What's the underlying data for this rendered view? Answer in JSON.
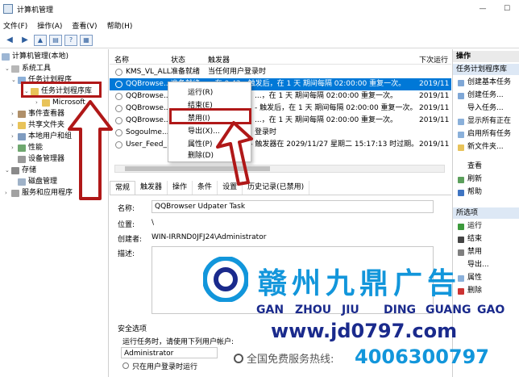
{
  "window": {
    "title": "计算机管理"
  },
  "menu": [
    "文件(F)",
    "操作(A)",
    "查看(V)",
    "帮助(H)"
  ],
  "tree": {
    "root": "计算机管理(本地)",
    "system_tools": "系统工具",
    "task_scheduler": "任务计划程序",
    "task_library": "任务计划程序库",
    "microsoft": "Microsoft",
    "event_viewer": "事件查看器",
    "shared_folders": "共享文件夹",
    "local_users": "本地用户和组",
    "performance": "性能",
    "device_manager": "设备管理器",
    "storage": "存储",
    "disk_management": "磁盘管理",
    "services": "服务和应用程序"
  },
  "grid": {
    "headers": {
      "name": "名称",
      "status": "状态",
      "triggers": "触发器",
      "next_run": "下次运行"
    },
    "rows": [
      {
        "name": "KMS_VL_ALL",
        "status": "准备就绪",
        "trigger": "当任何用户登录时",
        "next": ""
      },
      {
        "name": "QQBrowse...",
        "status": "准备就绪",
        "trigger": "...在 0:42 - 触发后，在 1 天 期间每隔 02:00:00 重复一次。",
        "next": "2019/11"
      },
      {
        "name": "QQBrowse...",
        "status": "",
        "trigger": "...，在 1 天 期间每隔 02:00:00 重复一次。",
        "next": "2019/11"
      },
      {
        "name": "QQBrowse...",
        "status": "",
        "trigger": "- 触发后，在 1 天 期间每隔 02:00:00 重复一次。",
        "next": "2019/11"
      },
      {
        "name": "QQBrowse...",
        "status": "",
        "trigger": "...，在 1 天 期间每隔 02:00:00 重复一次。",
        "next": "2019/11"
      },
      {
        "name": "Sogoulme...",
        "status": "",
        "trigger": "登录时",
        "next": ""
      },
      {
        "name": "User_Feed_...",
        "status": "",
        "trigger": "17 - 触发器在 2029/11/27 星期二 15:17:13 时过期。",
        "next": "2019/11"
      }
    ]
  },
  "context_menu": [
    "运行(R)",
    "结束(E)",
    "禁用(I)",
    "导出(X)...",
    "属性(P)",
    "删除(D)"
  ],
  "tabs": [
    "常规",
    "触发器",
    "操作",
    "条件",
    "设置",
    "历史记录(已禁用)"
  ],
  "detail": {
    "name_label": "名称:",
    "name_value": "QQBrowser Udpater Task",
    "location_label": "位置:",
    "location_value": "\\",
    "author_label": "创建者:",
    "author_value": "WIN-IRRND0JFJ24\\Administrator",
    "desc_label": "描述:",
    "security_label": "安全选项",
    "run_as_text": "运行任务时，请使用下列用户帐户:",
    "account_value": "Administrator",
    "radio_text": "只在用户登录时运行"
  },
  "actions": {
    "header": "操作",
    "section1": "任务计划程序库",
    "items1": [
      "创建基本任务",
      "创建任务...",
      "导入任务...",
      "显示所有正在",
      "启用所有任务",
      "新文件夹...",
      "查看",
      "刷新",
      "帮助"
    ],
    "section2": "所选项",
    "items2": [
      "运行",
      "结束",
      "禁用",
      "导出...",
      "属性",
      "删除"
    ]
  },
  "watermark": {
    "title": "赣州九鼎广告",
    "pinyin": [
      "GAN",
      "ZHOU",
      "JIU",
      "DING",
      "GUANG",
      "GAO"
    ],
    "url": "www.jd0797.com",
    "hotline_label": "全国免费服务热线:",
    "phone": "4006300797"
  },
  "colors": {
    "selection": "#0078d7",
    "annotation": "#b01818",
    "watermark_blue": "#1296db",
    "watermark_navy": "#1a2a8c"
  }
}
